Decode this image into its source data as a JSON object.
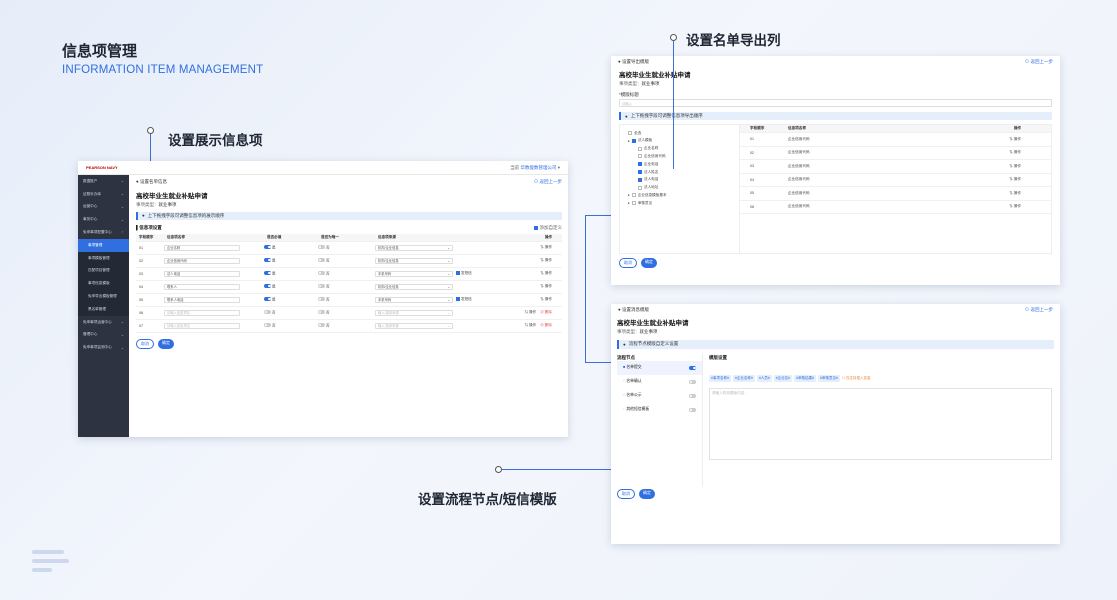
{
  "page": {
    "title": "信息项管理",
    "subtitle": "INFORMATION ITEM MANAGEMENT"
  },
  "callouts": {
    "display": "设置展示信息项",
    "export": "设置名单导出列",
    "flow": "设置流程节点/短信模版"
  },
  "colors": {
    "accent": "#2f6fe0",
    "sidebar": "#2d3340"
  },
  "win1": {
    "logo": "PEARSON NAVY",
    "company_label": "当前",
    "company": "华数能数管理公司",
    "back": "返回上一步",
    "crumb": "设置名单信息",
    "title": "高校毕业生就业补贴申请",
    "meta_k": "事项类型：",
    "meta_v": "就业事项",
    "note": "上下拖拽字段可调整信息项的展示顺序",
    "section": "信息项设置",
    "add_custom": "添加自定义",
    "headers": [
      "字段顺序",
      "信息项名称",
      "是否必填",
      "是否为唯一",
      "信息项来源",
      "操作"
    ],
    "rows": [
      {
        "no": "01",
        "name": "企业名称",
        "req": "是",
        "uniq": "否",
        "src": "机构/企业信息",
        "flag": "",
        "op": "操作"
      },
      {
        "no": "02",
        "name": "企业信用代码",
        "req": "是",
        "uniq": "否",
        "src": "机构/企业信息",
        "flag": "",
        "op": "操作"
      },
      {
        "no": "03",
        "name": "法人电话",
        "req": "是",
        "uniq": "否",
        "src": "手机号码",
        "flag": "发短信",
        "op": "操作"
      },
      {
        "no": "04",
        "name": "联系人",
        "req": "是",
        "uniq": "否",
        "src": "机构/企业信息",
        "flag": "",
        "op": "操作"
      },
      {
        "no": "05",
        "name": "联系人电话",
        "req": "是",
        "uniq": "否",
        "src": "手机号码",
        "flag": "发短信",
        "op": "操作"
      },
      {
        "no": "06",
        "name": "请输入信息项名",
        "req": "否",
        "uniq": "否",
        "src": "输入/选择来源",
        "flag": "",
        "op": "操作",
        "del": "删除"
      },
      {
        "no": "07",
        "name": "请输入信息项名",
        "req": "否",
        "uniq": "否",
        "src": "输入/选择来源",
        "flag": "",
        "op": "操作",
        "del": "删除"
      }
    ],
    "cancel": "取消",
    "confirm": "确定",
    "sidebar": [
      {
        "label": "数据推户",
        "type": "top"
      },
      {
        "label": "证照补办库",
        "type": "top"
      },
      {
        "label": "运营中心",
        "type": "top"
      },
      {
        "label": "事务中心",
        "type": "top"
      },
      {
        "label": "免申事项配置中心",
        "type": "open"
      },
      {
        "label": "事项管理",
        "type": "active"
      },
      {
        "label": "事项模板管理",
        "type": "sub"
      },
      {
        "label": "匹配项目管理",
        "type": "sub"
      },
      {
        "label": "事项信息模版",
        "type": "sub"
      },
      {
        "label": "免申导出模板管理",
        "type": "sub"
      },
      {
        "label": "黑名单管理",
        "type": "sub"
      },
      {
        "label": "免申事项运营中心",
        "type": "top"
      },
      {
        "label": "管理中心",
        "type": "top"
      },
      {
        "label": "免申事项监测中心",
        "type": "top"
      }
    ]
  },
  "win2": {
    "crumb": "设置导出模版",
    "back": "返回上一步",
    "title": "高校毕业生就业补贴申请",
    "meta_k": "事项类型：",
    "meta_v": "就业事项",
    "tpl_label": "*模版标题",
    "tpl_placeholder": "请输入",
    "note": "上下拖拽字段可调整信息项导出顺序",
    "tree": [
      {
        "label": "全选",
        "lvl": 0,
        "cb": false
      },
      {
        "label": "法人模板",
        "lvl": 0,
        "cb": true
      },
      {
        "label": "企业名称",
        "lvl": 1,
        "cb": false
      },
      {
        "label": "企业信用代码",
        "lvl": 1,
        "cb": false
      },
      {
        "label": "企业电话",
        "lvl": 1,
        "cb": true
      },
      {
        "label": "法人姓名",
        "lvl": 1,
        "cb": true
      },
      {
        "label": "法人电话",
        "lvl": 1,
        "cb": true
      },
      {
        "label": "法人地址",
        "lvl": 1,
        "cb": false
      },
      {
        "label": "企业信息模板基本",
        "lvl": 0,
        "cb": false
      },
      {
        "label": "审核意见",
        "lvl": 0,
        "cb": false
      }
    ],
    "headers": [
      "字段顺序",
      "信息项名称",
      "操作"
    ],
    "rows": [
      {
        "no": "01",
        "name": "企业信用代码",
        "op": "操作"
      },
      {
        "no": "02",
        "name": "企业信用代码",
        "op": "操作"
      },
      {
        "no": "03",
        "name": "企业信用代码",
        "op": "操作"
      },
      {
        "no": "04",
        "name": "企业信用代码",
        "op": "操作"
      },
      {
        "no": "05",
        "name": "企业信用代码",
        "op": "操作"
      },
      {
        "no": "06",
        "name": "企业信用代码",
        "op": "操作"
      }
    ],
    "cancel": "取消",
    "confirm": "确定"
  },
  "win3": {
    "crumb": "设置消息模版",
    "back": "返回上一步",
    "title": "高校毕业生就业补贴申请",
    "meta_k": "事项类型：",
    "meta_v": "就业事项",
    "note": "流程节点模版自定义设置",
    "nodes_title": "流程节点",
    "tpl_title": "模版设置",
    "nodes": [
      {
        "label": "名单提交",
        "on": true,
        "active": true
      },
      {
        "label": "名单确认",
        "on": false,
        "active": false
      },
      {
        "label": "名单公示",
        "on": false,
        "active": false
      },
      {
        "label": "其他短信模板",
        "on": false,
        "active": false
      }
    ],
    "chips": [
      "#事项名称#",
      "#企业名称#",
      "#人员#",
      "#企业名#",
      "#审核结果#",
      "#审核意见#"
    ],
    "chip_hint": "仅支持插入变量",
    "textarea_placeholder": "请输入短信模版内容...",
    "cancel": "取消",
    "confirm": "确定"
  }
}
